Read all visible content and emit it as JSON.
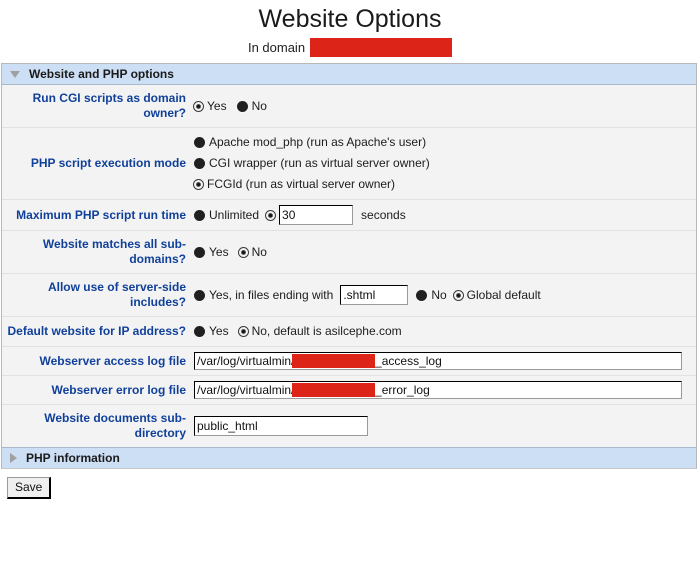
{
  "header": {
    "title": "Website Options",
    "subtitle_prefix": "In domain",
    "domain_redacted": true
  },
  "sections": {
    "website_php": {
      "label": "Website and PHP options",
      "expanded": true,
      "toggle_icon": "triangle-down-icon"
    },
    "php_info": {
      "label": "PHP information",
      "expanded": false,
      "toggle_icon": "triangle-right-icon"
    }
  },
  "fields": {
    "run_cgi": {
      "label": "Run CGI scripts as domain owner?",
      "options": [
        {
          "label": "Yes",
          "selected": true
        },
        {
          "label": "No",
          "selected": false
        }
      ]
    },
    "php_mode": {
      "label": "PHP script execution mode",
      "options": [
        {
          "label": "Apache mod_php (run as Apache's user)",
          "selected": false
        },
        {
          "label": "CGI wrapper (run as virtual server owner)",
          "selected": false
        },
        {
          "label": "FCGId (run as virtual server owner)",
          "selected": true
        }
      ]
    },
    "max_run_time": {
      "label": "Maximum PHP script run time",
      "options": [
        {
          "label": "Unlimited",
          "selected": false
        },
        {
          "label": "",
          "selected": true
        }
      ],
      "value": "30",
      "unit": "seconds"
    },
    "match_subdomains": {
      "label": "Website matches all sub-domains?",
      "options": [
        {
          "label": "Yes",
          "selected": false
        },
        {
          "label": "No",
          "selected": true
        }
      ]
    },
    "server_side_includes": {
      "label": "Allow use of server-side includes?",
      "options": [
        {
          "label": "Yes, in files ending with",
          "selected": false
        },
        {
          "label": "No",
          "selected": false
        },
        {
          "label": "Global default",
          "selected": true
        }
      ],
      "extension_value": ".shtml"
    },
    "default_website": {
      "label": "Default website for IP address?",
      "options": [
        {
          "label": "Yes",
          "selected": false
        },
        {
          "label": "No, default is asilcephe.com",
          "selected": true
        }
      ]
    },
    "access_log": {
      "label": "Webserver access log file",
      "value_prefix": "/var/log/virtualmin/d",
      "value_suffix": "_access_log",
      "redacted": true
    },
    "error_log": {
      "label": "Webserver error log file",
      "value_prefix": "/var/log/virtualmin/d",
      "value_suffix": "_error_log",
      "redacted": true
    },
    "doc_subdir": {
      "label": "Website documents sub-directory",
      "value": "public_html"
    }
  },
  "footer": {
    "save_label": "Save"
  },
  "colors": {
    "label_blue": "#10409a",
    "section_blue": "#cddff5",
    "redaction_red": "#dd2418",
    "body_gray": "#f3f3f3"
  }
}
